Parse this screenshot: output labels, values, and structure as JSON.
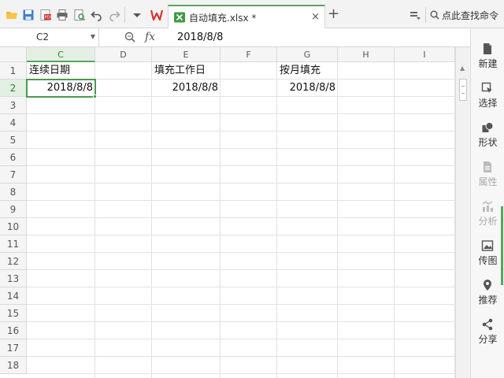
{
  "tab": {
    "filename": "自动填充.xlsx *",
    "close": "×"
  },
  "toolbar": {
    "new_tab": "+",
    "search_command": "点此查找命令"
  },
  "formula_bar": {
    "cell_ref": "C2",
    "fx": "fx",
    "value": "2018/8/8"
  },
  "columns": [
    "C",
    "D",
    "E",
    "F",
    "G",
    "H",
    "I"
  ],
  "rows": [
    "1",
    "2",
    "3",
    "4",
    "5",
    "6",
    "7",
    "8",
    "9",
    "10",
    "11",
    "12",
    "13",
    "14",
    "15",
    "16",
    "17",
    "18"
  ],
  "cells": {
    "c1": "连续日期",
    "e1": "填充工作日",
    "g1": "按月填充",
    "c2": "2018/8/8",
    "e2": "2018/8/8",
    "g2": "2018/8/8"
  },
  "right_panel": [
    {
      "label": "新建",
      "icon": "file-icon"
    },
    {
      "label": "选择",
      "icon": "cursor-icon"
    },
    {
      "label": "形状",
      "icon": "shape-icon"
    },
    {
      "label": "属性",
      "icon": "properties-icon"
    },
    {
      "label": "分析",
      "icon": "analysis-icon"
    },
    {
      "label": "传图",
      "icon": "image-upload-icon"
    },
    {
      "label": "推荐",
      "icon": "location-icon"
    },
    {
      "label": "分享",
      "icon": "share-icon"
    }
  ],
  "colors": {
    "accent": "#58a55c",
    "wps_red": "#d9322b"
  }
}
